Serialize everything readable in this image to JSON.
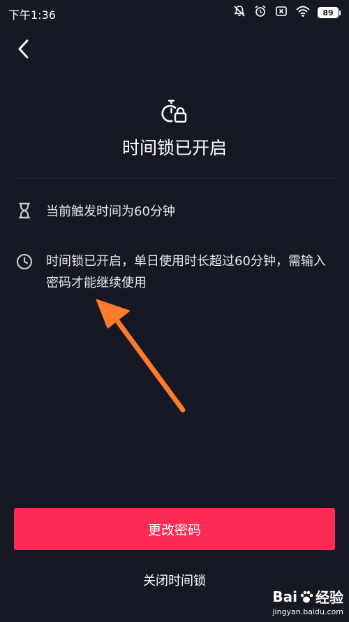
{
  "status_bar": {
    "time": "下午1:36",
    "battery": "89",
    "icons": [
      "notification-muted-icon",
      "alarm-icon",
      "close-box-icon",
      "wifi-icon",
      "battery-icon"
    ]
  },
  "header": {
    "back_icon": "chevron-left-icon",
    "lock_icon": "timer-lock-icon",
    "title": "时间锁已开启"
  },
  "info_items": [
    {
      "icon": "hourglass-icon",
      "text": "当前触发时间为60分钟"
    },
    {
      "icon": "clock-icon",
      "text": "时间锁已开启，单日使用时长超过60分钟，需输入密码才能继续使用"
    }
  ],
  "actions": {
    "change_password": "更改密码",
    "close_lock": "关闭时间锁"
  },
  "watermark": {
    "brand_left": "Bai",
    "brand_right": "经验",
    "url": "jingyan.baidu.com"
  },
  "colors": {
    "background": "#161824",
    "primary": "#fe2c55",
    "annotation_arrow": "#ff7a2a"
  }
}
